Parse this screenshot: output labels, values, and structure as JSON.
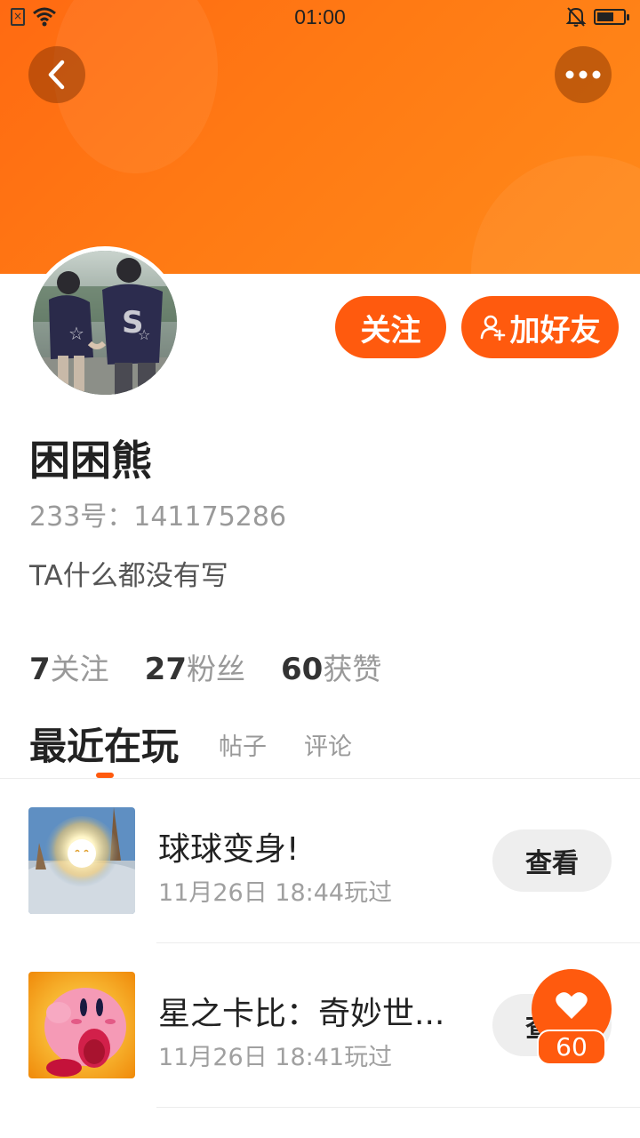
{
  "status_bar": {
    "time": "01:00"
  },
  "colors": {
    "accent": "#ff5a0e",
    "header_gradient_start": "#ff6a12",
    "header_gradient_end": "#ff8a1a"
  },
  "header": {
    "back_icon": "chevron-left-icon",
    "more_icon": "more-dots-icon"
  },
  "profile": {
    "follow_label": "关注",
    "add_friend_label": "加好友",
    "username": "困困熊",
    "user_id": "233号：141175286",
    "bio": "TA什么都没有写"
  },
  "stats": [
    {
      "value": "7",
      "label": "关注"
    },
    {
      "value": "27",
      "label": "粉丝"
    },
    {
      "value": "60",
      "label": "获赞"
    }
  ],
  "tabs": [
    {
      "label": "最近在玩",
      "active": true
    },
    {
      "label": "帖子",
      "active": false
    },
    {
      "label": "评论",
      "active": false
    }
  ],
  "games": [
    {
      "name": "球球变身!",
      "played": "11月26日 18:44玩过",
      "action": "查看"
    },
    {
      "name": "星之卡比：奇妙世...",
      "played": "11月26日 18:41玩过",
      "action": "查看"
    }
  ],
  "like_fab": {
    "count": "60",
    "icon": "heart-icon"
  }
}
